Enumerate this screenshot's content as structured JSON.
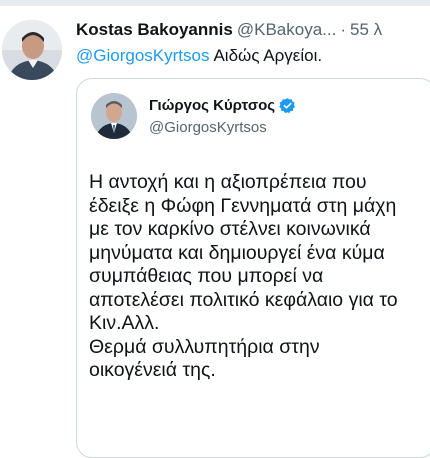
{
  "tweet": {
    "author_name": "Kostas Bakoyannis",
    "author_handle": "@KBakoya...",
    "separator": "·",
    "timestamp": "55 λ",
    "reply_mention": "@GiorgosKyrtsos",
    "reply_text": "Αιδώς Αργείοι."
  },
  "quoted_tweet": {
    "author_name": "Γιώργος Κύρτσος",
    "author_handle": "@GiorgosKyrtsos",
    "verified": true,
    "lines": [
      "Η αντοχή και η αξιοπρέπεια που",
      "έδειξε η Φώφη Γεννηματά στη μάχη",
      "με τον καρκίνο στέλνει κοινωνικά",
      "μηνύματα και δημιουργεί ένα κύμα",
      "συμπάθειας που μπορεί να",
      "αποτελέσει πολιτικό κεφάλαιο για το",
      "Κιν.Αλλ.",
      "Θερμά συλλυπητήρια στην",
      "οικογένειά της."
    ]
  },
  "colors": {
    "link": "#1d9bf0",
    "secondary_text": "#536471",
    "border": "#cfd9de",
    "verified": "#1d9bf0"
  }
}
